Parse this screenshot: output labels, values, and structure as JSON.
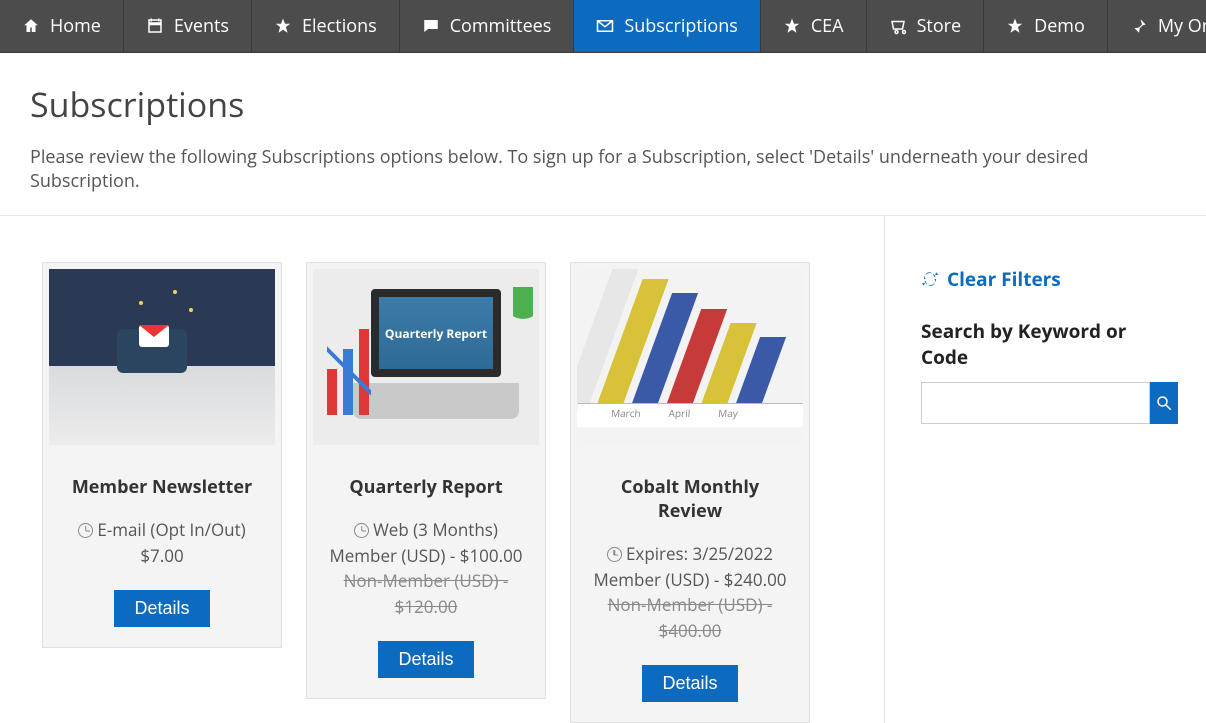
{
  "nav": [
    {
      "icon": "home-icon",
      "label": "Home",
      "active": false
    },
    {
      "icon": "calendar-icon",
      "label": "Events",
      "active": false
    },
    {
      "icon": "star-icon",
      "label": "Elections",
      "active": false
    },
    {
      "icon": "chat-icon",
      "label": "Committees",
      "active": false
    },
    {
      "icon": "envelope-icon",
      "label": "Subscriptions",
      "active": true
    },
    {
      "icon": "star-icon",
      "label": "CEA",
      "active": false
    },
    {
      "icon": "cart-icon",
      "label": "Store",
      "active": false
    },
    {
      "icon": "star-icon",
      "label": "Demo",
      "active": false
    },
    {
      "icon": "pin-icon",
      "label": "My Orders",
      "active": false
    }
  ],
  "header": {
    "title": "Subscriptions",
    "subtitle": "Please review the following Subscriptions options below. To sign up for a Subscription, select 'Details' underneath your desired Subscription."
  },
  "cards": [
    {
      "title": "Member Newsletter",
      "delivery": "E-mail (Opt In/Out)",
      "price": "$7.00",
      "strike_price": null,
      "member_line": null,
      "button": "Details",
      "img_label": null
    },
    {
      "title": "Quarterly Report",
      "delivery": "Web (3 Months)",
      "member_line": "Member (USD) - $100.00",
      "strike_price": "Non-Member (USD) - $120.00",
      "price": null,
      "button": "Details",
      "img_label": "Quarterly Report"
    },
    {
      "title": "Cobalt Monthly Review",
      "delivery": "Expires: 3/25/2022",
      "member_line": "Member (USD) - $240.00",
      "strike_price": "Non-Member (USD) - $400.00",
      "price": null,
      "button": "Details",
      "img_label": null,
      "axis_labels": [
        "March",
        "April",
        "May"
      ]
    }
  ],
  "sidebar": {
    "clear_filters": "Clear Filters",
    "search_label": "Search by Keyword or Code",
    "search_value": ""
  }
}
